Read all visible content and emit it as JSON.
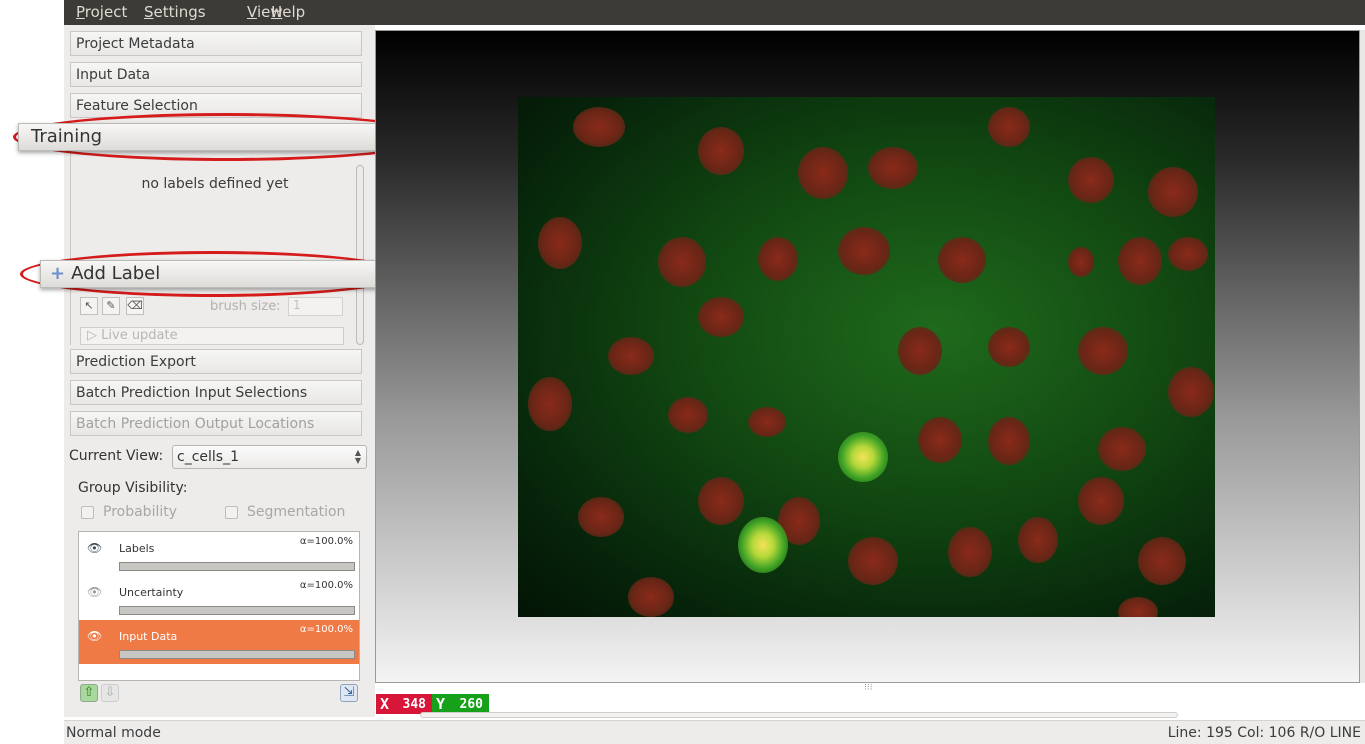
{
  "menu": {
    "items": [
      "Project",
      "Settings",
      "View",
      "Help"
    ]
  },
  "applets": {
    "project_metadata": "Project Metadata",
    "input_data": "Input Data",
    "feature_selection": "Feature Selection",
    "training": "Training",
    "prediction_export": "Prediction Export",
    "batch_input": "Batch Prediction Input Selections",
    "batch_output": "Batch Prediction Output Locations"
  },
  "training": {
    "empty_text": "no labels defined yet",
    "add_label": "Add Label",
    "brush_size_label": "brush size:",
    "brush_size_value": "1",
    "live_update": "Live update"
  },
  "view": {
    "current_view_label": "Current View:",
    "current_view_value": "c_cells_1",
    "group_visibility_label": "Group Visibility:",
    "probability_label": "Probability",
    "segmentation_label": "Segmentation"
  },
  "layers": [
    {
      "name": "Labels",
      "alpha": "α=100.0%",
      "opacity": 1.0
    },
    {
      "name": "Uncertainty",
      "alpha": "α=100.0%",
      "opacity": 1.0
    },
    {
      "name": "Input Data",
      "alpha": "α=100.0%",
      "opacity": 1.0,
      "selected": true
    }
  ],
  "coords": {
    "x_label": "X",
    "x_value": "348",
    "y_label": "Y",
    "y_value": "260"
  },
  "status": {
    "mode": "Normal mode",
    "position": "Line: 195 Col: 106",
    "flags": "R/O LINE"
  },
  "colors": {
    "highlight": "#d51b1b",
    "selected_layer": "#f07a45",
    "x_coord": "#d8163a",
    "y_coord": "#17a01a"
  },
  "icons": [
    "eye-icon",
    "plus-icon",
    "arrow-up-icon",
    "arrow-down-icon",
    "export-icon"
  ]
}
